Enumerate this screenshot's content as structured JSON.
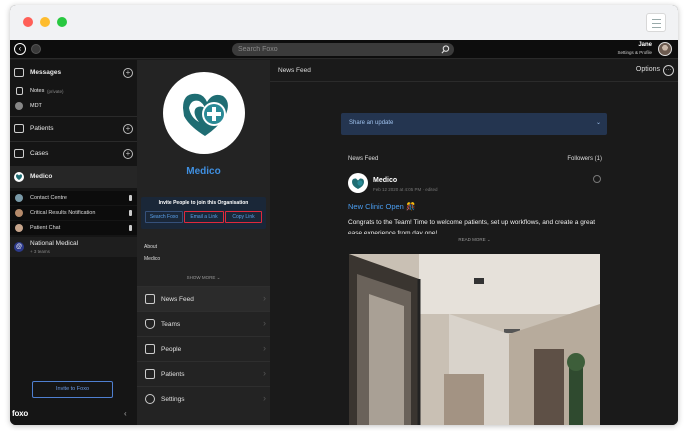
{
  "window": {
    "colors": {
      "close": "#ff5f57",
      "minimize": "#febc2e",
      "maximize": "#28c840"
    },
    "menu_icon": "sliders-icon"
  },
  "topbar": {
    "search_placeholder": "Search Foxo",
    "user_name": "Jane",
    "user_subtitle": "Settings & Profile",
    "icons": [
      "back-circle-icon",
      "forward-circle-icon",
      "search-icon",
      "avatar"
    ]
  },
  "sidebar": {
    "messages": "Messages",
    "notes": "Notes",
    "notes_tag": "(private)",
    "mdt": "MDT",
    "patients": "Patients",
    "cases": "Cases",
    "medico": "Medico",
    "channels": [
      "Contact Centre",
      "Critical Results Notification",
      "Patient Chat"
    ],
    "national": "National Medical",
    "national_sub": "+ 3 teams",
    "invite_button": "Invite to Foxo",
    "logo": "foxo",
    "collapse": "‹",
    "accent": "#4f7fd0"
  },
  "org": {
    "name": "Medico",
    "invite_title": "Invite People to join this Organisation",
    "buttons": [
      "Search Foxo",
      "Email a Link",
      "Copy Link"
    ],
    "highlight_color": "#e0283c",
    "about_label": "About",
    "about_value": "Medico",
    "show_more": "SHOW MORE ⌄",
    "nav": [
      "News Feed",
      "Teams",
      "People",
      "Patients",
      "Settings"
    ]
  },
  "main": {
    "title": "News Feed",
    "options": "Options",
    "share_placeholder": "Share an update",
    "feed_label": "News Feed",
    "followers": "Followers (1)",
    "post": {
      "author": "Medico",
      "date": "Feb 12 2020 at 4:05 PM · edited",
      "headline": "New Clinic Open 🎊",
      "body": "Congrats to the Team! Time to welcome patients, set up workflows, and create a great ease experience from day one!",
      "read_more": "READ MORE ⌄"
    }
  }
}
